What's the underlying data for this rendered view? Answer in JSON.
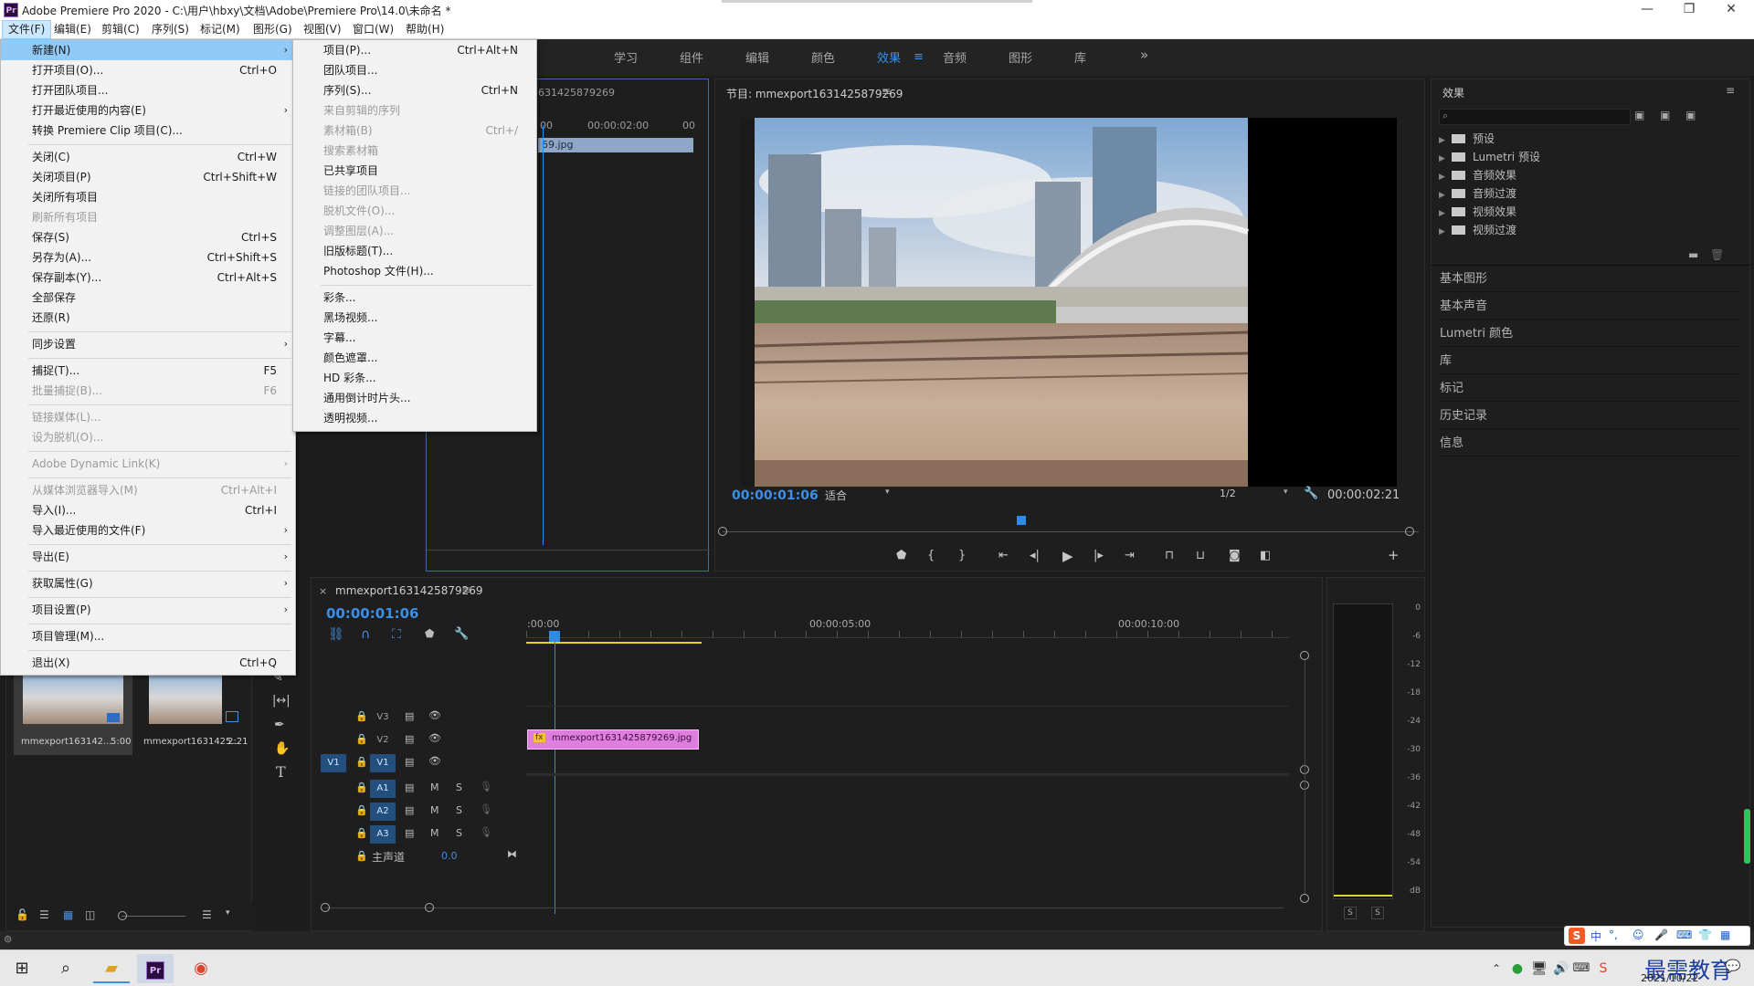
{
  "window": {
    "title": "Adobe Premiere Pro 2020 - C:\\用户\\hbxy\\文档\\Adobe\\Premiere Pro\\14.0\\未命名 *",
    "app_icon_text": "Pr"
  },
  "menubar": {
    "items": [
      "文件(F)",
      "编辑(E)",
      "剪辑(C)",
      "序列(S)",
      "标记(M)",
      "图形(G)",
      "视图(V)",
      "窗口(W)",
      "帮助(H)"
    ]
  },
  "workspaces": {
    "items": [
      "学习",
      "组件",
      "编辑",
      "颜色",
      "效果",
      "音频",
      "图形",
      "库"
    ],
    "active": "效果",
    "more": "»"
  },
  "file_menu": {
    "items": [
      {
        "label": "新建(N)",
        "shortcut": "",
        "submenu": true,
        "disabled": false
      },
      {
        "label": "打开项目(O)...",
        "shortcut": "Ctrl+O",
        "submenu": false,
        "disabled": false
      },
      {
        "label": "打开团队项目...",
        "shortcut": "",
        "submenu": false,
        "disabled": false
      },
      {
        "label": "打开最近使用的内容(E)",
        "shortcut": "",
        "submenu": true,
        "disabled": false
      },
      {
        "label": "转换 Premiere Clip 项目(C)...",
        "shortcut": "",
        "submenu": false,
        "disabled": false
      },
      {
        "label": "关闭(C)",
        "shortcut": "Ctrl+W",
        "submenu": false,
        "disabled": false
      },
      {
        "label": "关闭项目(P)",
        "shortcut": "Ctrl+Shift+W",
        "submenu": false,
        "disabled": false
      },
      {
        "label": "关闭所有项目",
        "shortcut": "",
        "submenu": false,
        "disabled": false
      },
      {
        "label": "刷新所有项目",
        "shortcut": "",
        "submenu": false,
        "disabled": true
      },
      {
        "label": "保存(S)",
        "shortcut": "Ctrl+S",
        "submenu": false,
        "disabled": false
      },
      {
        "label": "另存为(A)...",
        "shortcut": "Ctrl+Shift+S",
        "submenu": false,
        "disabled": false
      },
      {
        "label": "保存副本(Y)...",
        "shortcut": "Ctrl+Alt+S",
        "submenu": false,
        "disabled": false
      },
      {
        "label": "全部保存",
        "shortcut": "",
        "submenu": false,
        "disabled": false
      },
      {
        "label": "还原(R)",
        "shortcut": "",
        "submenu": false,
        "disabled": false
      },
      {
        "label": "同步设置",
        "shortcut": "",
        "submenu": true,
        "disabled": false
      },
      {
        "label": "捕捉(T)...",
        "shortcut": "F5",
        "submenu": false,
        "disabled": false
      },
      {
        "label": "批量捕捉(B)...",
        "shortcut": "F6",
        "submenu": false,
        "disabled": true
      },
      {
        "label": "链接媒体(L)...",
        "shortcut": "",
        "submenu": false,
        "disabled": true
      },
      {
        "label": "设为脱机(O)...",
        "shortcut": "",
        "submenu": false,
        "disabled": true
      },
      {
        "label": "Adobe Dynamic Link(K)",
        "shortcut": "",
        "submenu": true,
        "disabled": true
      },
      {
        "label": "从媒体浏览器导入(M)",
        "shortcut": "Ctrl+Alt+I",
        "submenu": false,
        "disabled": true
      },
      {
        "label": "导入(I)...",
        "shortcut": "Ctrl+I",
        "submenu": false,
        "disabled": false
      },
      {
        "label": "导入最近使用的文件(F)",
        "shortcut": "",
        "submenu": true,
        "disabled": false
      },
      {
        "label": "导出(E)",
        "shortcut": "",
        "submenu": true,
        "disabled": false
      },
      {
        "label": "获取属性(G)",
        "shortcut": "",
        "submenu": true,
        "disabled": false
      },
      {
        "label": "项目设置(P)",
        "shortcut": "",
        "submenu": true,
        "disabled": false
      },
      {
        "label": "项目管理(M)...",
        "shortcut": "",
        "submenu": false,
        "disabled": false
      },
      {
        "label": "退出(X)",
        "shortcut": "Ctrl+Q",
        "submenu": false,
        "disabled": false
      }
    ]
  },
  "new_submenu": {
    "items": [
      {
        "label": "项目(P)...",
        "shortcut": "Ctrl+Alt+N",
        "disabled": false
      },
      {
        "label": "团队项目...",
        "shortcut": "",
        "disabled": false
      },
      {
        "label": "序列(S)...",
        "shortcut": "Ctrl+N",
        "disabled": false
      },
      {
        "label": "来自剪辑的序列",
        "shortcut": "",
        "disabled": true
      },
      {
        "label": "素材箱(B)",
        "shortcut": "Ctrl+/",
        "disabled": true
      },
      {
        "label": "搜索素材箱",
        "shortcut": "",
        "disabled": true
      },
      {
        "label": "已共享项目",
        "shortcut": "",
        "disabled": false
      },
      {
        "label": "链接的团队项目...",
        "shortcut": "",
        "disabled": true
      },
      {
        "label": "脱机文件(O)...",
        "shortcut": "",
        "disabled": true
      },
      {
        "label": "调整图层(A)...",
        "shortcut": "",
        "disabled": true
      },
      {
        "label": "旧版标题(T)...",
        "shortcut": "",
        "disabled": false
      },
      {
        "label": "Photoshop 文件(H)...",
        "shortcut": "",
        "disabled": false
      },
      {
        "label": "彩条...",
        "shortcut": "",
        "disabled": false
      },
      {
        "label": "黑场视频...",
        "shortcut": "",
        "disabled": false
      },
      {
        "label": "字幕...",
        "shortcut": "",
        "disabled": false
      },
      {
        "label": "颜色遮罩...",
        "shortcut": "",
        "disabled": false
      },
      {
        "label": "HD 彩条...",
        "shortcut": "",
        "disabled": false
      },
      {
        "label": "通用倒计时片头...",
        "shortcut": "",
        "disabled": false
      },
      {
        "label": "透明视频...",
        "shortcut": "",
        "disabled": false
      }
    ]
  },
  "source_panel": {
    "tab_partial": "631425879269",
    "ruler_labels": [
      "00",
      "00:00:02:00",
      "00"
    ],
    "clip_partial": "69.jpg"
  },
  "program_monitor": {
    "title": "节目: mmexport1631425879269",
    "timecode": "00:00:01:06",
    "fit": "适合",
    "resolution": "1/2",
    "duration": "00:00:02:21"
  },
  "effects_panel": {
    "title": "效果",
    "search_placeholder": "",
    "folders": [
      "预设",
      "Lumetri 预设",
      "音频效果",
      "音频过渡",
      "视频效果",
      "视频过渡"
    ],
    "side_tabs": [
      "基本图形",
      "基本声音",
      "Lumetri 颜色",
      "库",
      "标记",
      "历史记录",
      "信息"
    ]
  },
  "project_panel": {
    "thumbs": [
      {
        "name": "mmexport163142...",
        "duration": "5:00"
      },
      {
        "name": "mmexport1631425...",
        "duration": "2:21"
      }
    ]
  },
  "timeline": {
    "tab_close": "×",
    "sequence_name": "mmexport1631425879269",
    "timecode": "00:00:01:06",
    "ruler_labels": [
      ":00:00",
      "00:00:05:00",
      "00:00:10:00"
    ],
    "video_tracks": [
      "V3",
      "V2",
      "V1"
    ],
    "audio_tracks": [
      "A1",
      "A2",
      "A3"
    ],
    "source_patch": "V1",
    "mute_label": "M",
    "solo_label": "S",
    "master_label": "主声道",
    "master_value": "0.0",
    "clip_name": "mmexport1631425879269.jpg",
    "clip_fx": "fx"
  },
  "audio_meter": {
    "scale": [
      "0",
      "-6",
      "-12",
      "-18",
      "-24",
      "-30",
      "-36",
      "-42",
      "-48",
      "-54",
      "dB"
    ],
    "solo_buttons": [
      "S",
      "S"
    ]
  },
  "tray": {
    "ime": "中",
    "watermark": "最需教育",
    "date": "2021/10/22"
  },
  "colors": {
    "accent_blue": "#3b8fe8",
    "clip_pink": "#e07ee0",
    "menu_highlight": "#91c9f7",
    "playhead": "#2d8ceb"
  }
}
